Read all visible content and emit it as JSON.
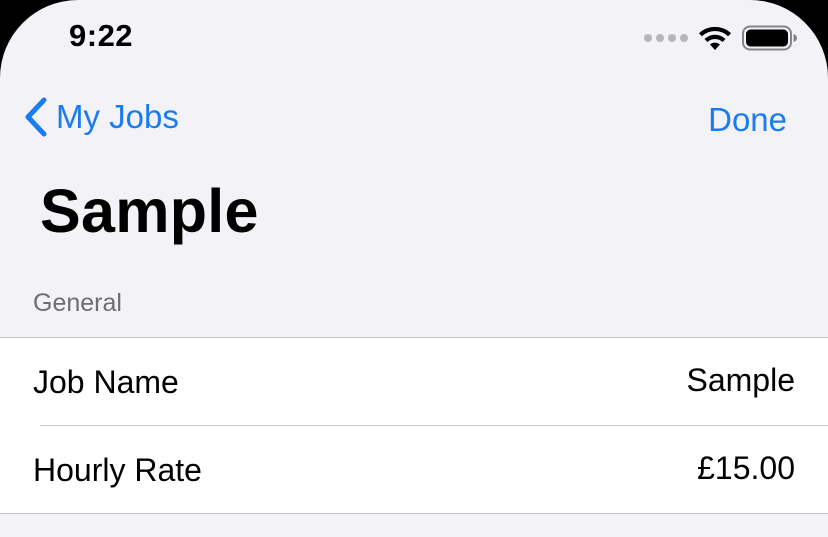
{
  "status_bar": {
    "time": "9:22",
    "icons": [
      "signal-dots-icon",
      "wifi-icon",
      "battery-icon"
    ]
  },
  "nav": {
    "back_label": "My Jobs",
    "done_label": "Done",
    "tint_color": "#1a7cf0"
  },
  "page": {
    "title": "Sample"
  },
  "section": {
    "header": "General",
    "rows": [
      {
        "label": "Job Name",
        "value": "Sample"
      },
      {
        "label": "Hourly Rate",
        "value": "£15.00"
      }
    ]
  }
}
